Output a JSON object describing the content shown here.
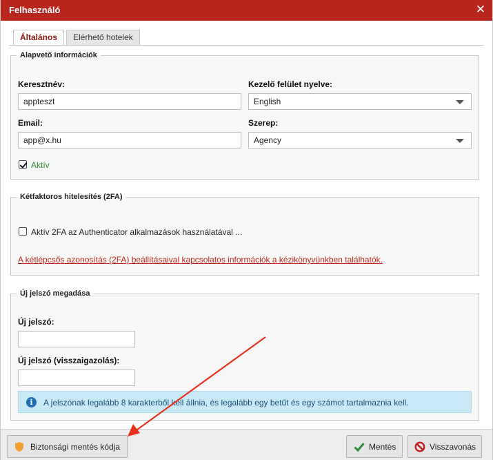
{
  "dialog": {
    "title": "Felhasználó",
    "close_symbol": "✕"
  },
  "tabs": [
    {
      "label": "Általános",
      "active": true
    },
    {
      "label": "Elérhető hotelek",
      "active": false
    }
  ],
  "basic_info": {
    "legend": "Alapvető információk",
    "first_name_label": "Keresztnév:",
    "first_name_value": "appteszt",
    "language_label": "Kezelő felület nyelve:",
    "language_value": "English",
    "email_label": "Email:",
    "email_value": "app@x.hu",
    "role_label": "Szerep:",
    "role_value": "Agency",
    "active_label": "Aktív",
    "active_checked": true
  },
  "two_fa": {
    "legend": "Kétfaktoros hitelesítés (2FA)",
    "checkbox_label": "Aktív 2FA az Authenticator alkalmazások használatával ...",
    "checked": false,
    "link_text": "A kétlépcsős azonosítás (2FA) beállításaival kapcsolatos információk a kézikönyvünkben találhatók."
  },
  "password": {
    "legend": "Új jelszó megadása",
    "new_label": "Új jelszó:",
    "new_value": "",
    "confirm_label": "Új jelszó (visszaigazolás):",
    "confirm_value": "",
    "info_text": "A jelszónak legalább 8 karakterből kell állnia, és legalább egy betűt és egy számot tartalmaznia kell."
  },
  "footer": {
    "backup_label": "Biztonsági mentés kódja",
    "save_label": "Mentés",
    "cancel_label": "Visszavonás"
  },
  "colors": {
    "title_bar": "#b9261d",
    "active_tab_text": "#8b1a14",
    "link": "#c2261d",
    "active_text": "#2e8b2e",
    "info_bg": "#c8e9f6",
    "save_icon": "#2f8a3a",
    "cancel_icon": "#c21f1f",
    "shield_icon": "#f0a030",
    "annotation_arrow": "#e8321f"
  },
  "icons": {
    "close": "close-icon",
    "select_arrow": "chevron-down-icon",
    "info": "info-icon",
    "backup": "shield-icon",
    "save": "checkmark-icon",
    "cancel": "prohibited-icon"
  }
}
